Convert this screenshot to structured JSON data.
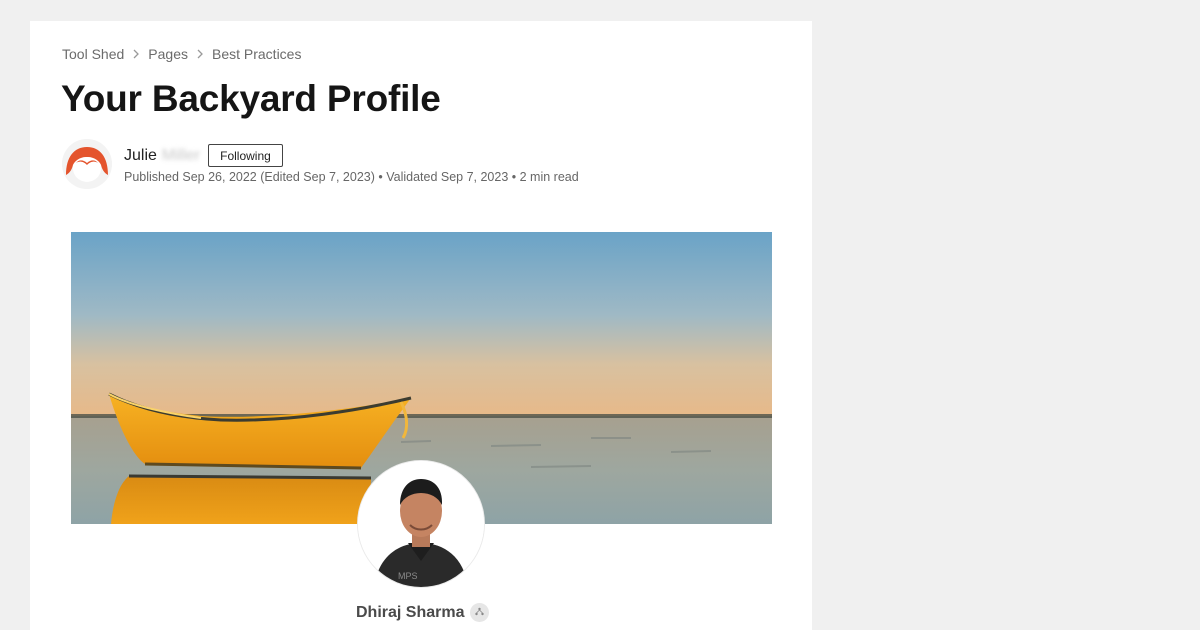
{
  "breadcrumb": {
    "items": [
      "Tool Shed",
      "Pages",
      "Best Practices"
    ]
  },
  "page": {
    "title": "Your Backyard Profile"
  },
  "author": {
    "first_name": "Julie",
    "last_name": "Miller",
    "follow_label": "Following",
    "meta": "Published Sep 26, 2022 (Edited Sep 7, 2023) • Validated Sep 7, 2023 • 2 min read"
  },
  "hero": {
    "image": "yellow-boat-on-calm-water"
  },
  "profile": {
    "name": "Dhiraj Sharma",
    "badge_icon": "user-rank-icon"
  },
  "colors": {
    "background": "#f0f0f0",
    "card": "#ffffff",
    "avatar_accent": "#e4542d",
    "boat": "#f0a21a"
  }
}
